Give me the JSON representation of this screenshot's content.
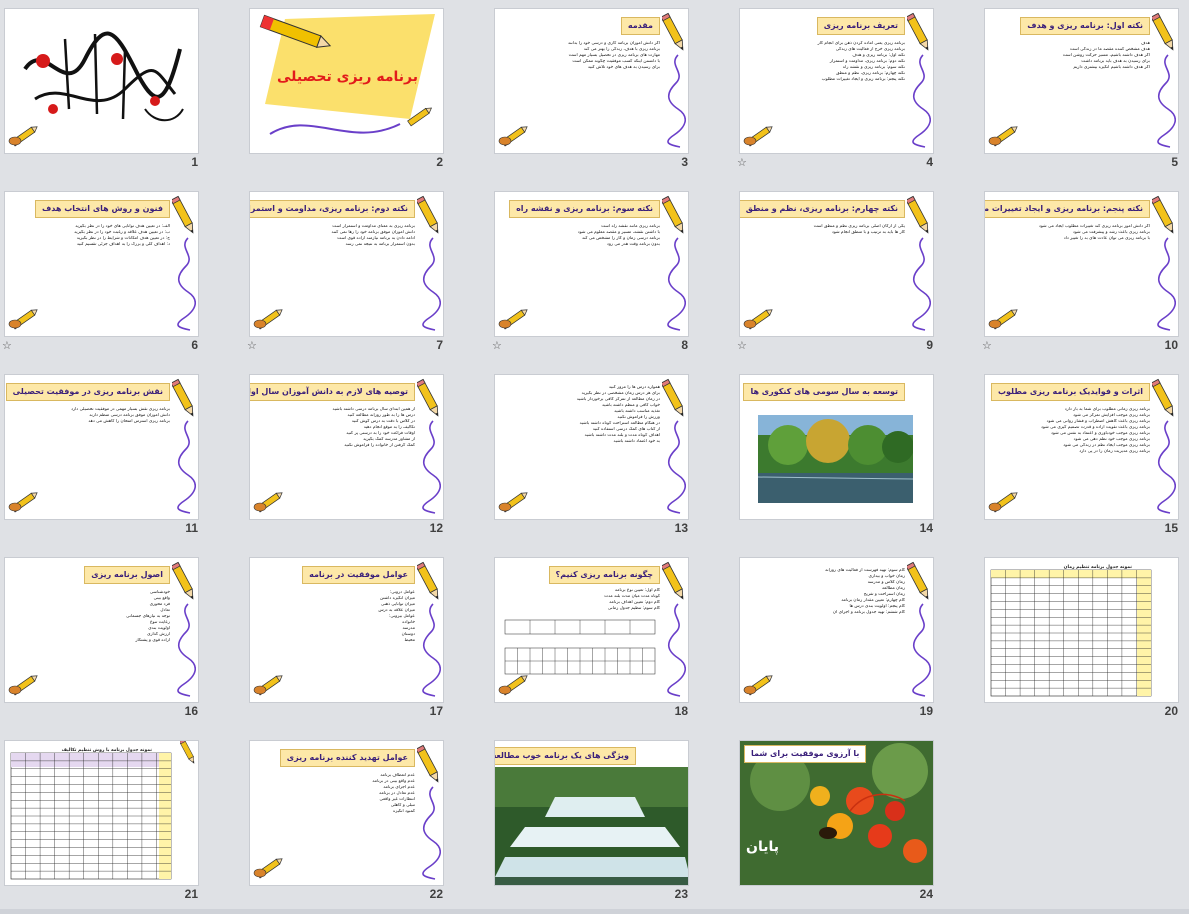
{
  "slides": [
    {
      "num": "1",
      "kind": "calligraphy",
      "star": false
    },
    {
      "num": "2",
      "kind": "cover",
      "title": "برنامه ریزی تحصیلی",
      "star": false
    },
    {
      "num": "3",
      "kind": "text",
      "title": "مقدمه",
      "lines": [
        "اگر دانش آموزان برنامه کاری و درسی خود را بدانند",
        "برنامه ریزی با هدف، زندگی را بهتر می کند",
        "مهارت های برنامه ریزی در تحصیل بسیار مهم است",
        "با دانستن اینکه کسب موفقیت چگونه ممکن است",
        "برای رسیدن به هدف های خود تلاش کنید"
      ],
      "star": false
    },
    {
      "num": "4",
      "kind": "text",
      "title": "تعریف برنامه ریزی",
      "lines": [
        "برنامه ریزی یعنی آماده کردن ذهن برای انجام کار",
        "برنامه ریزی خرج از فعالیت های زندگی",
        "نکته اول: برنامه ریزی و هدف",
        "نکته دوم: برنامه ریزی، مداومت و استمرار",
        "نکته سوم: برنامه ریزی و نقشه راه",
        "نکته چهارم: برنامه ریزی، نظم و منطق",
        "نکته پنجم: برنامه ریزی و ایجاد تغییرات مطلوب"
      ],
      "star": true
    },
    {
      "num": "5",
      "kind": "text",
      "title": "نکته اول: برنامه ریزی و هدف",
      "lines": [
        "هدف",
        "هدف مشخص کننده مقصد ما در زندگی است",
        "اگر هدف داشته باشیم، مسیر حرکت روشن است",
        "برای رسیدن به هدف باید برنامه داشت",
        "اگر هدف داشته باشیم انگیزه بیشتری داریم"
      ],
      "star": false
    },
    {
      "num": "6",
      "kind": "text",
      "title": "فنون و روش های انتخاب هدف",
      "lines": [
        "الف: در تعیین هدف توانایی های خود را در نظر بگیرید",
        "ب: در تعیین هدف علاقه و رغبت خود را در نظر بگیرید",
        "ج: در تعیین هدف امکانات و شرایط را در نظر بگیرید",
        "د: اهداف کلی و بزرگ را به اهداف جزئی تقسیم کنید"
      ],
      "star": true
    },
    {
      "num": "7",
      "kind": "text",
      "title": "نکته دوم: برنامه ریزی، مداومت و استمرار",
      "lines": [
        "برنامه ریزی به معنای مداومت و استمرار است",
        "دانش آموزان موفق برنامه خود را رها نمی کنند",
        "ادامه دادن به برنامه نیازمند اراده قوی است",
        "بدون استمرار برنامه به نتیجه نمی رسد"
      ],
      "star": true
    },
    {
      "num": "8",
      "kind": "text",
      "title": "نکته سوم: برنامه ریزی و نقشه راه",
      "lines": [
        "برنامه ریزی مانند نقشه راه است",
        "با داشتن نقشه، مسیر و مقصد معلوم می شود",
        "برنامه درسی زمان و کار را مشخص می کند",
        "بدون برنامه وقت هدر می رود"
      ],
      "star": true
    },
    {
      "num": "9",
      "kind": "text",
      "title": "نکته چهارم: برنامه ریزی، نظم و منطق",
      "lines": [
        "یکی از ارکان اصلی برنامه ریزی نظم و منطق است",
        "کار ها باید به ترتیب و با منطق انجام شود"
      ],
      "star": true
    },
    {
      "num": "10",
      "kind": "text",
      "title": "نکته پنجم: برنامه ریزی و ایجاد تغییرات مطلوب",
      "lines": [
        "اگر دانش آموز برنامه ریزی کند تغییرات مطلوب ایجاد می شود",
        "برنامه ریزی باعث رشد و پیشرفت می شود",
        "با برنامه ریزی می توان عادت های بد را تغییر داد"
      ],
      "star": true
    },
    {
      "num": "11",
      "kind": "text",
      "title": "نقش برنامه ریزی در موفقیت تحصیلی",
      "lines": [
        "برنامه ریزی نقش بسیار مهمی در موفقیت تحصیلی دارد",
        "دانش آموزان موفق برنامه درسی منظم دارند",
        "برنامه ریزی استرس امتحان را کاهش می دهد"
      ],
      "star": false
    },
    {
      "num": "12",
      "kind": "text",
      "title": "توصیه های لازم به دانش آموزان سال اول دوره متوسطه",
      "lines": [
        "از همین ابتدای سال برنامه درسی داشته باشید",
        "درس ها را به طور روزانه مطالعه کنید",
        "در کلاس با دقت به درس گوش کنید",
        "تکالیف را به موقع انجام دهید",
        "اوقات فراغت خود را به درستی پر کنید",
        "از مشاور مدرسه کمک بگیرید",
        "کمک گرفتن از خانواده را فراموش نکنید"
      ],
      "star": false
    },
    {
      "num": "13",
      "kind": "text",
      "title": "",
      "lines": [
        "همواره درس ها را مرور کنید",
        "برای هر درس زمان مشخصی در نظر بگیرید",
        "در زمان مطالعه از تمرکز کافی برخوردار باشید",
        "خواب کافی و منظم داشته باشید",
        "تغذیه مناسب داشته باشید",
        "ورزش را فراموش نکنید",
        "در هنگام مطالعه استراحت کوتاه داشته باشید",
        "از کتاب های کمک درسی استفاده کنید",
        "اهداف کوتاه مدت و بلند مدت داشته باشید",
        "به خود اعتماد داشته باشید"
      ],
      "star": false
    },
    {
      "num": "14",
      "kind": "photo-forest",
      "title": "توسعه به سال سومی های کنکوری ها",
      "star": false
    },
    {
      "num": "15",
      "kind": "text",
      "title": "اثرات و فوایدیک برنامه ریزی مطلوب",
      "lines": [
        "برنامه ریزی زمانی مطلوب برای شما به بار دارد",
        "برنامه ریزی موجب افزایش تمرکز می شود",
        "برنامه ریزی باعث کاهش اضطراب و فشار روانی می شود",
        "برنامه ریزی باعث تقویت اراده و قدرت تصمیم گیری می شود",
        "برنامه ریزی موجب خودباوری و اعتماد به نفس می شود",
        "برنامه ریزی موجب خود نظم دهی می شود",
        "برنامه ریزی موجب ایجاد نظم در زندگی می شود",
        "برنامه ریزی مدیریت زمان را در پی دارد"
      ],
      "star": false
    },
    {
      "num": "16",
      "kind": "text",
      "title": "اصول برنامه ریزی",
      "lines": [
        "خودشناسی",
        "واقع بینی",
        "فرد محوری",
        "تعادل",
        "توجه به نیازهای جسمانی",
        "رعایت تنوع",
        "اولویت بندی",
        "ارزش گذاری",
        "اراده قوی و پشتکار"
      ],
      "star": false
    },
    {
      "num": "17",
      "kind": "text",
      "title": "عوامل موفقیت در برنامه",
      "lines": [
        "عوامل درونی:",
        "میزان انگیزه داشتن",
        "میزان توانایی ذهنی",
        "میزان علاقه به درس",
        "عوامل بیرونی:",
        "خانواده",
        "مدرسه",
        "دوستان",
        "محیط"
      ],
      "star": false
    },
    {
      "num": "18",
      "kind": "table",
      "title": "چگونه برنامه ریزی کنیم؟",
      "lines": [
        "گام اول: تعیین نوع برنامه",
        "کوتاه مدت     میان مدت     بلند مدت",
        "گام دوم: تعیین اهداف برنامه",
        "گام سوم: تنظیم جدول زمانی"
      ],
      "star": false
    },
    {
      "num": "19",
      "kind": "text",
      "title": "",
      "lines": [
        "گام سوم: تهیه فهرست از فعالیت های روزانه",
        "زمان خواب و بیداری",
        "زمان کلاس و مدرسه",
        "زمان مطالعه",
        "زمان استراحت و تفریح",
        "گام چهارم: تعیین مقدار زمان برنامه",
        "گام پنجم: اولویت بندی درس ها",
        "گام ششم: تهیه جدول برنامه و اجرای آن"
      ],
      "star": false
    },
    {
      "num": "20",
      "kind": "schedule",
      "title": "نمونه جدول برنامه تنظیم زمان",
      "star": false
    },
    {
      "num": "21",
      "kind": "schedule2",
      "title": "نمونه جدول برنامه با روش تنظیم تکالیف",
      "star": false
    },
    {
      "num": "22",
      "kind": "text",
      "title": "عوامل تهدید کننده برنامه ریزی",
      "lines": [
        "عدم انعطاف برنامه",
        "عدم واقع بینی در برنامه",
        "عدم اجرای برنامه",
        "عدم تعادل در برنامه",
        "انتظارات غیر واقعی",
        "تنبلی و کاهلی",
        "کمبود انگیزه"
      ],
      "star": false
    },
    {
      "num": "23",
      "kind": "photo-waterfall",
      "title": "ویژگی های یک برنامه خوب مطالعه",
      "star": false
    },
    {
      "num": "24",
      "kind": "photo-flower",
      "title": "با آرزوی موفقیت برای شما",
      "end": "پایان",
      "star": false
    }
  ],
  "colors": {
    "title_bg": "#fde8a8",
    "title_text": "#3a1f7a",
    "cover_bg": "#fbe06c",
    "cover_title": "#e21b1b",
    "curl": "#6a3fc9"
  }
}
